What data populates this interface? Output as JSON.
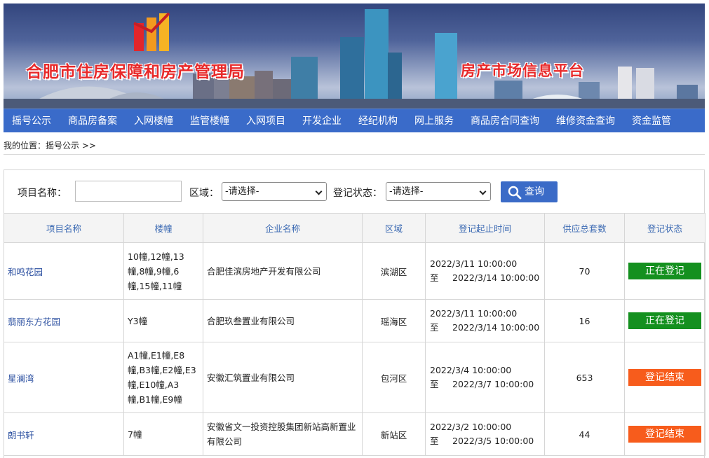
{
  "banner": {
    "title": "合肥市住房保障和房产管理局",
    "subtitle": "房产市场信息平台"
  },
  "nav": [
    "摇号公示",
    "商品房备案",
    "入网楼幢",
    "监管楼幢",
    "入网项目",
    "开发企业",
    "经纪机构",
    "网上服务",
    "商品房合同查询",
    "维修资金查询",
    "资金监管"
  ],
  "breadcrumb": "我的位置：摇号公示 >>",
  "search": {
    "project_label": "项目名称：",
    "project_value": "",
    "area_label": "区域：",
    "area_selected": "-请选择-",
    "status_label": "登记状态：",
    "status_selected": "-请选择-",
    "button_label": "查询",
    "button_icon": "search-icon"
  },
  "table": {
    "headers": [
      "项目名称",
      "楼幢",
      "企业名称",
      "区域",
      "登记起止时间",
      "供应总套数",
      "登记状态"
    ],
    "to_label": "至",
    "rows": [
      {
        "name": "和鸣花园",
        "buildings": "10幢,12幢,13幢,8幢,9幢,6幢,15幢,11幢",
        "company": "合肥佳滨房地产开发有限公司",
        "district": "滨湖区",
        "start": "2022/3/11 10:00:00",
        "end": "2022/3/14 10:00:00",
        "total": "70",
        "status": "正在登记",
        "status_color": "#14901f"
      },
      {
        "name": "翡丽东方花园",
        "buildings": "Y3幢",
        "company": "合肥玖叁置业有限公司",
        "district": "瑶海区",
        "start": "2022/3/11 10:00:00",
        "end": "2022/3/14 10:00:00",
        "total": "16",
        "status": "正在登记",
        "status_color": "#14901f"
      },
      {
        "name": "星澜湾",
        "buildings": "A1幢,E1幢,E8幢,B3幢,E2幢,E3幢,E10幢,A3幢,B1幢,E9幢",
        "company": "安徽汇筑置业有限公司",
        "district": "包河区",
        "start": "2022/3/4 10:00:00",
        "end": "2022/3/7 10:00:00",
        "total": "653",
        "status": "登记结束",
        "status_color": "#f75c1c"
      },
      {
        "name": "朗书轩",
        "buildings": "7幢",
        "company": "安徽省文一投资控股集团新站高新置业有限公司",
        "district": "新站区",
        "start": "2022/3/2 10:00:00",
        "end": "2022/3/5 10:00:00",
        "total": "44",
        "status": "登记结束",
        "status_color": "#f75c1c"
      }
    ]
  }
}
